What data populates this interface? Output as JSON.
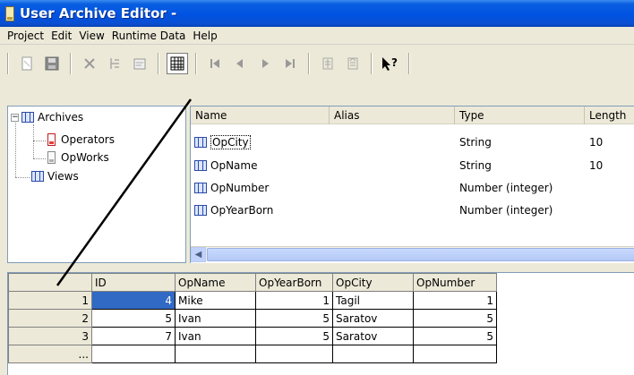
{
  "window": {
    "title": "User Archive Editor -"
  },
  "menu": [
    "Project",
    "Edit",
    "View",
    "Runtime Data",
    "Help"
  ],
  "toolbar": {
    "buttons": [
      "new-icon",
      "save-icon",
      "delete-icon",
      "cut-icon",
      "properties-icon",
      "table-view-icon",
      "first-record-icon",
      "previous-record-icon",
      "next-record-icon",
      "last-record-icon",
      "import-icon",
      "export-icon",
      "context-help-icon"
    ]
  },
  "tree": {
    "root": "Archives",
    "children": [
      "Operators",
      "OpWorks"
    ],
    "views": "Views"
  },
  "fields": {
    "columns": [
      "Name",
      "Alias",
      "Type",
      "Length"
    ],
    "rows": [
      {
        "name": "OpCity",
        "alias": "",
        "type": "String",
        "length": "10"
      },
      {
        "name": "OpName",
        "alias": "",
        "type": "String",
        "length": "10"
      },
      {
        "name": "OpNumber",
        "alias": "",
        "type": "Number (integer)",
        "length": ""
      },
      {
        "name": "OpYearBorn",
        "alias": "",
        "type": "Number (integer)",
        "length": ""
      }
    ]
  },
  "data_grid": {
    "columns": [
      "ID",
      "OpName",
      "OpYearBorn",
      "OpCity",
      "OpNumber"
    ],
    "rows": [
      {
        "index": "1",
        "id": "4",
        "opname": "Mike",
        "opyearborn": "1",
        "opcity": "Tagil",
        "opnumber": "1"
      },
      {
        "index": "2",
        "id": "5",
        "opname": "Ivan",
        "opyearborn": "5",
        "opcity": "Saratov",
        "opnumber": "5"
      },
      {
        "index": "3",
        "id": "7",
        "opname": "Ivan",
        "opyearborn": "5",
        "opcity": "Saratov",
        "opnumber": "5"
      }
    ],
    "new_row_marker": "..."
  },
  "colors": {
    "title_bar": "#0053e2",
    "selection": "#316ac5",
    "pane_border": "#7f9db9"
  }
}
